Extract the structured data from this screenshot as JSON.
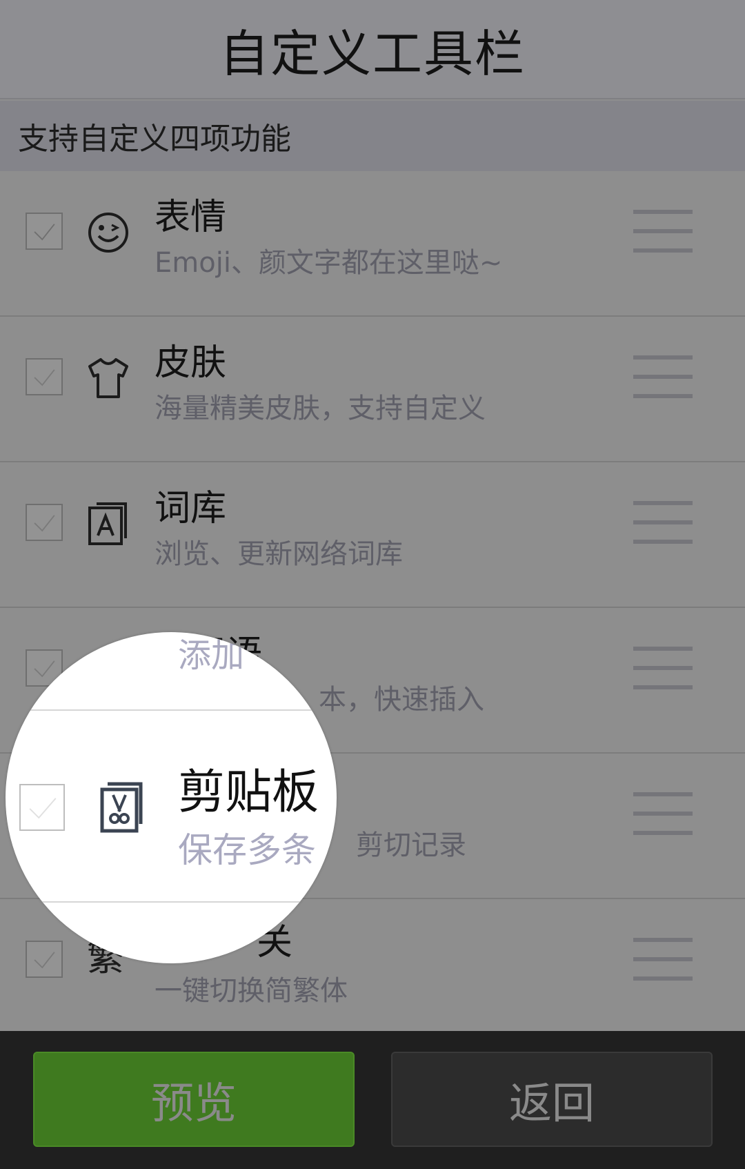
{
  "header": {
    "title": "自定义工具栏"
  },
  "subheader": {
    "text": "支持自定义四项功能"
  },
  "items": [
    {
      "title": "表情",
      "desc": "Emoji、颜文字都在这里哒~",
      "icon": "emoji-face-icon",
      "checked": true
    },
    {
      "title": "皮肤",
      "desc": "海量精美皮肤，支持自定义",
      "icon": "tshirt-icon",
      "checked": true
    },
    {
      "title": "词库",
      "desc": "浏览、更新网络词库",
      "icon": "dictionary-icon",
      "checked": true
    },
    {
      "title": "常用语",
      "desc": "本，快速插入",
      "icon": "phrase-icon",
      "checked": true
    },
    {
      "title": "剪贴板",
      "desc": "剪切记录",
      "icon": "clipboard-scissors-icon",
      "checked": true
    },
    {
      "title": "关",
      "desc": "一键切换简繁体",
      "icon": "traditional-char-icon",
      "checked": true
    }
  ],
  "magnifier": {
    "top_text": "添加",
    "title": "剪贴板",
    "desc": "保存多条",
    "trad_icon_glyph": "繁"
  },
  "buttons": {
    "preview": "预览",
    "back": "返回"
  },
  "colors": {
    "preview_bg": "#3f7a1f",
    "overlay": "#8e8e8e",
    "bottom_bar": "#1f1f1f"
  }
}
